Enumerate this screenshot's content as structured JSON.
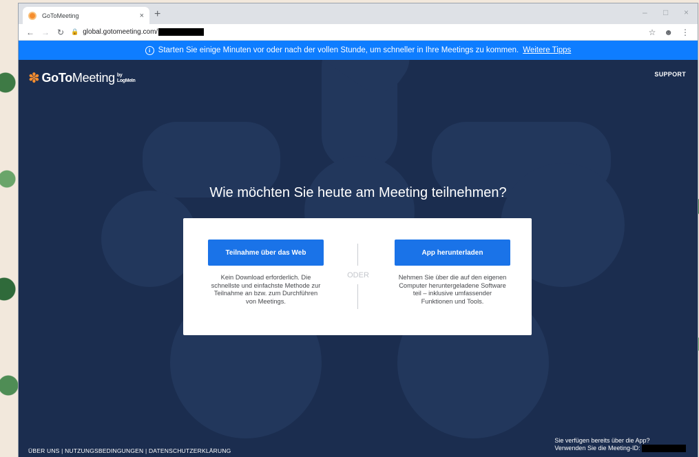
{
  "browser": {
    "tab_title": "GoToMeeting",
    "tab_close": "×",
    "new_tab": "+",
    "url": "global.gotomeeting.com/",
    "window_controls": [
      "–",
      "□",
      "×"
    ]
  },
  "banner": {
    "text": "Starten Sie einige Minuten vor oder nach der vollen Stunde, um schneller in Ihre Meetings zu kommen.",
    "link": "Weitere Tipps"
  },
  "header": {
    "logo_goto": "GoTo",
    "logo_meeting": "Meeting",
    "logo_by_line1": "by",
    "logo_by_line2": "LogMeIn",
    "support": "SUPPORT"
  },
  "main": {
    "heading": "Wie möchten Sie heute am Meeting teilnehmen?",
    "web_button": "Teilnahme über das Web",
    "web_desc": "Kein Download erforderlich. Die schnellste und einfachste Methode zur Teilnahme an bzw. zum Durchführen von Meetings.",
    "or_label": "ODER",
    "app_button": "App herunterladen",
    "app_desc": "Nehmen Sie über die auf den eigenen Computer heruntergeladene Software teil – inklusive umfassender Funktionen und Tools."
  },
  "footer": {
    "about": "ÜBER UNS",
    "terms": "NUTZUNGSBEDINGUNGEN",
    "privacy": "DATENSCHUTZERKLÄRUNG",
    "separator": "|",
    "app_note_line1": "Sie verfügen bereits über die App?",
    "app_note_line2": "Verwenden Sie die Meeting-ID:"
  },
  "colors": {
    "page_bg": "#1b2d4f",
    "banner_bg": "#0e7dff",
    "button_blue": "#1a73e8",
    "logo_orange": "#f68d2e"
  }
}
